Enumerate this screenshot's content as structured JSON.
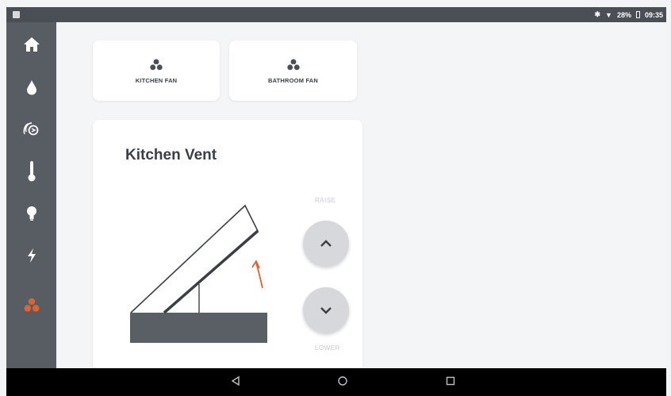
{
  "status_bar": {
    "bluetooth": "✱",
    "signal": "▼",
    "battery": "28%",
    "time": "09:35"
  },
  "sidebar": {
    "items": [
      {
        "name": "home-icon",
        "active": false
      },
      {
        "name": "water-drop-icon",
        "active": false
      },
      {
        "name": "thermostat-dial-icon",
        "active": false
      },
      {
        "name": "thermometer-icon",
        "active": false
      },
      {
        "name": "lightbulb-icon",
        "active": false
      },
      {
        "name": "lightning-icon",
        "active": false
      },
      {
        "name": "fan-icon",
        "active": true
      }
    ]
  },
  "tiles": [
    {
      "label": "KITCHEN FAN"
    },
    {
      "label": "BATHROOM FAN"
    }
  ],
  "vent": {
    "title": "Kitchen Vent",
    "raise_label": "RAISE",
    "lower_label": "LOWER"
  },
  "colors": {
    "sidebar_bg": "#585d64",
    "accent": "#e0632f",
    "text": "#3b3f45"
  }
}
